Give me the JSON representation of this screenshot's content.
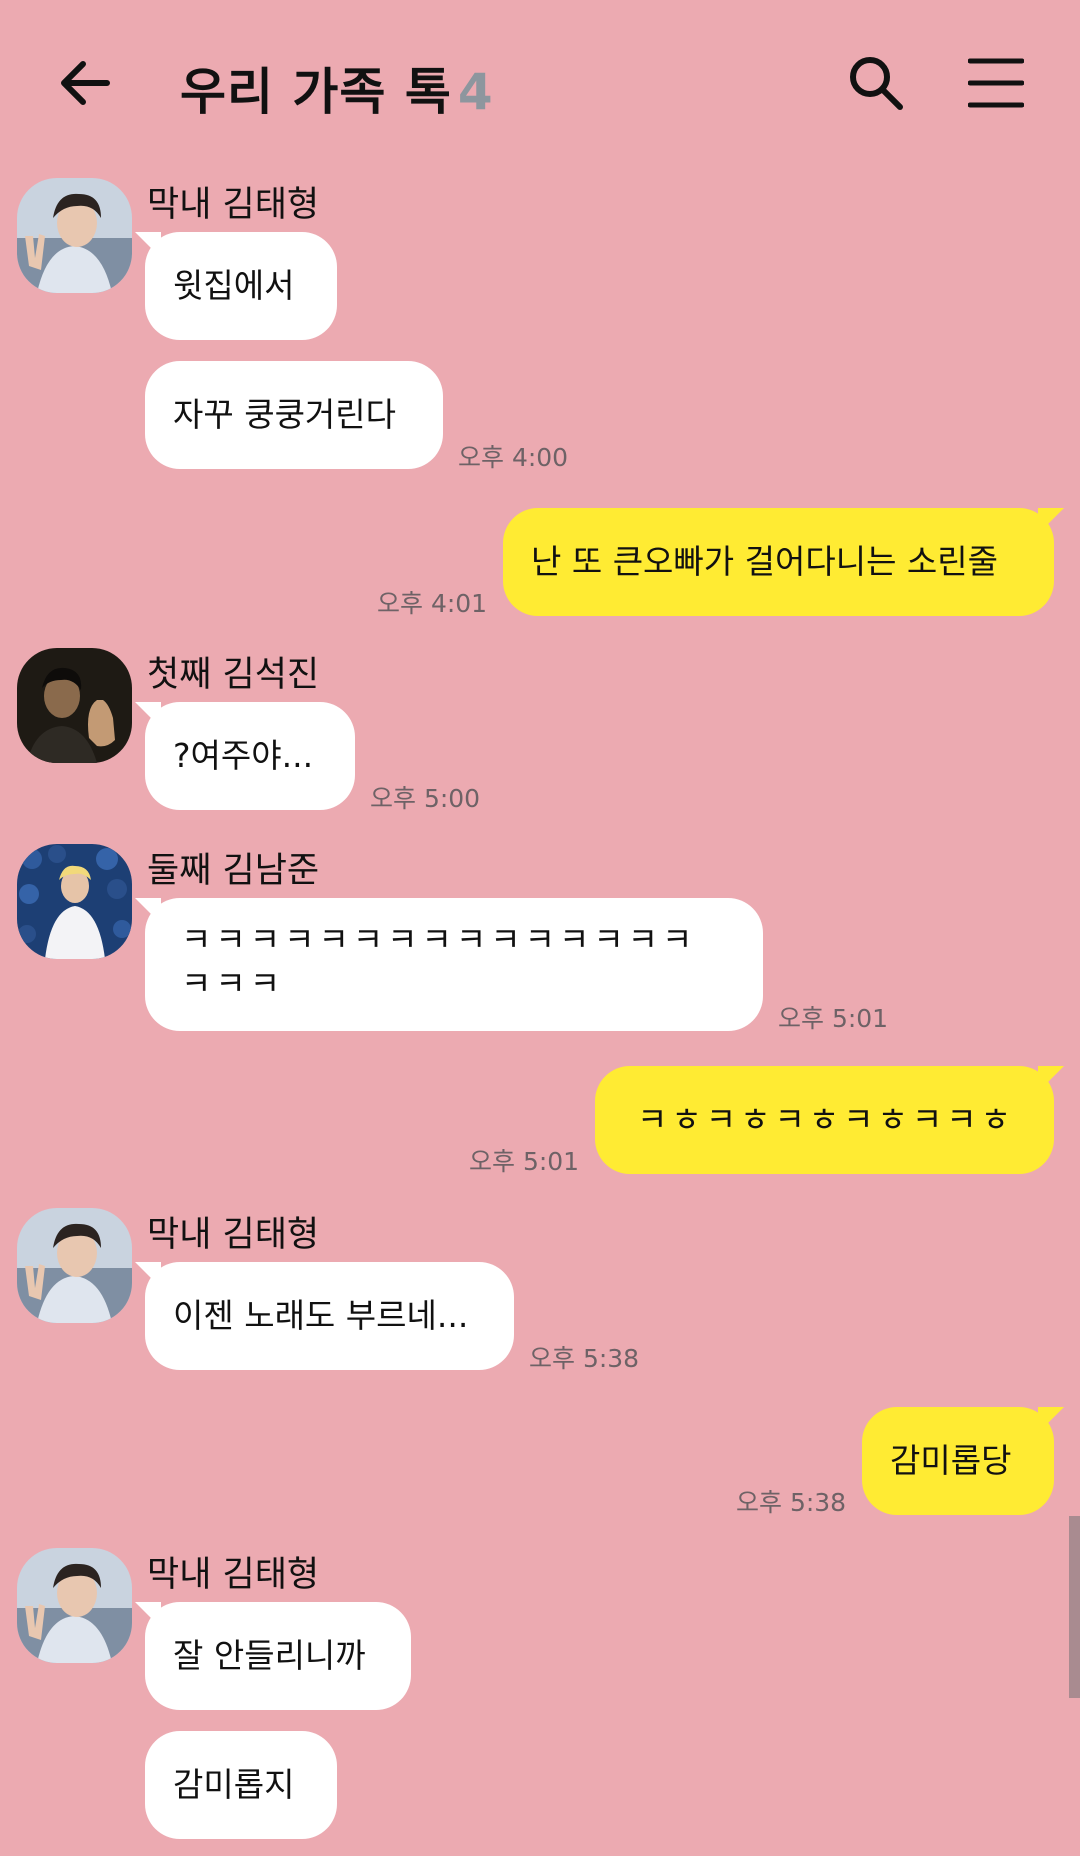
{
  "header": {
    "title": "우리 가족 톡",
    "member_count": "4"
  },
  "senders": {
    "taehyung": "막내 김태형",
    "seokjin": "첫째 김석진",
    "namjoon": "둘째 김남준"
  },
  "messages": [
    {
      "sender": "막내 김태형",
      "text": "윗집에서",
      "mine": false
    },
    {
      "sender": "막내 김태형",
      "text": "자꾸 쿵쿵거린다",
      "time": "오후 4:00",
      "mine": false
    },
    {
      "text": "난 또 큰오빠가 걸어다니는 소린줄",
      "time": "오후 4:01",
      "mine": true
    },
    {
      "sender": "첫째 김석진",
      "text": "?여주야...",
      "time": "오후 5:00",
      "mine": false
    },
    {
      "sender": "둘째 김남준",
      "text_line1": "ㅋㅋㅋㅋㅋㅋㅋㅋㅋㅋㅋㅋㅋㅋㅋ",
      "text_line2": "ㅋㅋㅋ",
      "time": "오후 5:01",
      "mine": false
    },
    {
      "text": "ㅋㅎㅋㅎㅋㅎㅋㅎㅋㅋㅎ",
      "time": "오후 5:01",
      "mine": true
    },
    {
      "sender": "막내 김태형",
      "text": "이젠 노래도 부르네...",
      "time": "오후 5:38",
      "mine": false
    },
    {
      "text": "감미롭당",
      "time": "오후 5:38",
      "mine": true
    },
    {
      "sender": "막내 김태형",
      "text": "잘 안들리니까",
      "mine": false
    },
    {
      "sender": "막내 김태형",
      "text": "감미롭지",
      "mine": false
    }
  ],
  "colors": {
    "background": "#ecaab1",
    "my_bubble": "#ffeb33",
    "their_bubble": "#ffffff",
    "member_count": "#8d969e",
    "timestamp": "#6e6266"
  },
  "icons": [
    "back-arrow-icon",
    "search-icon",
    "hamburger-menu-icon"
  ]
}
